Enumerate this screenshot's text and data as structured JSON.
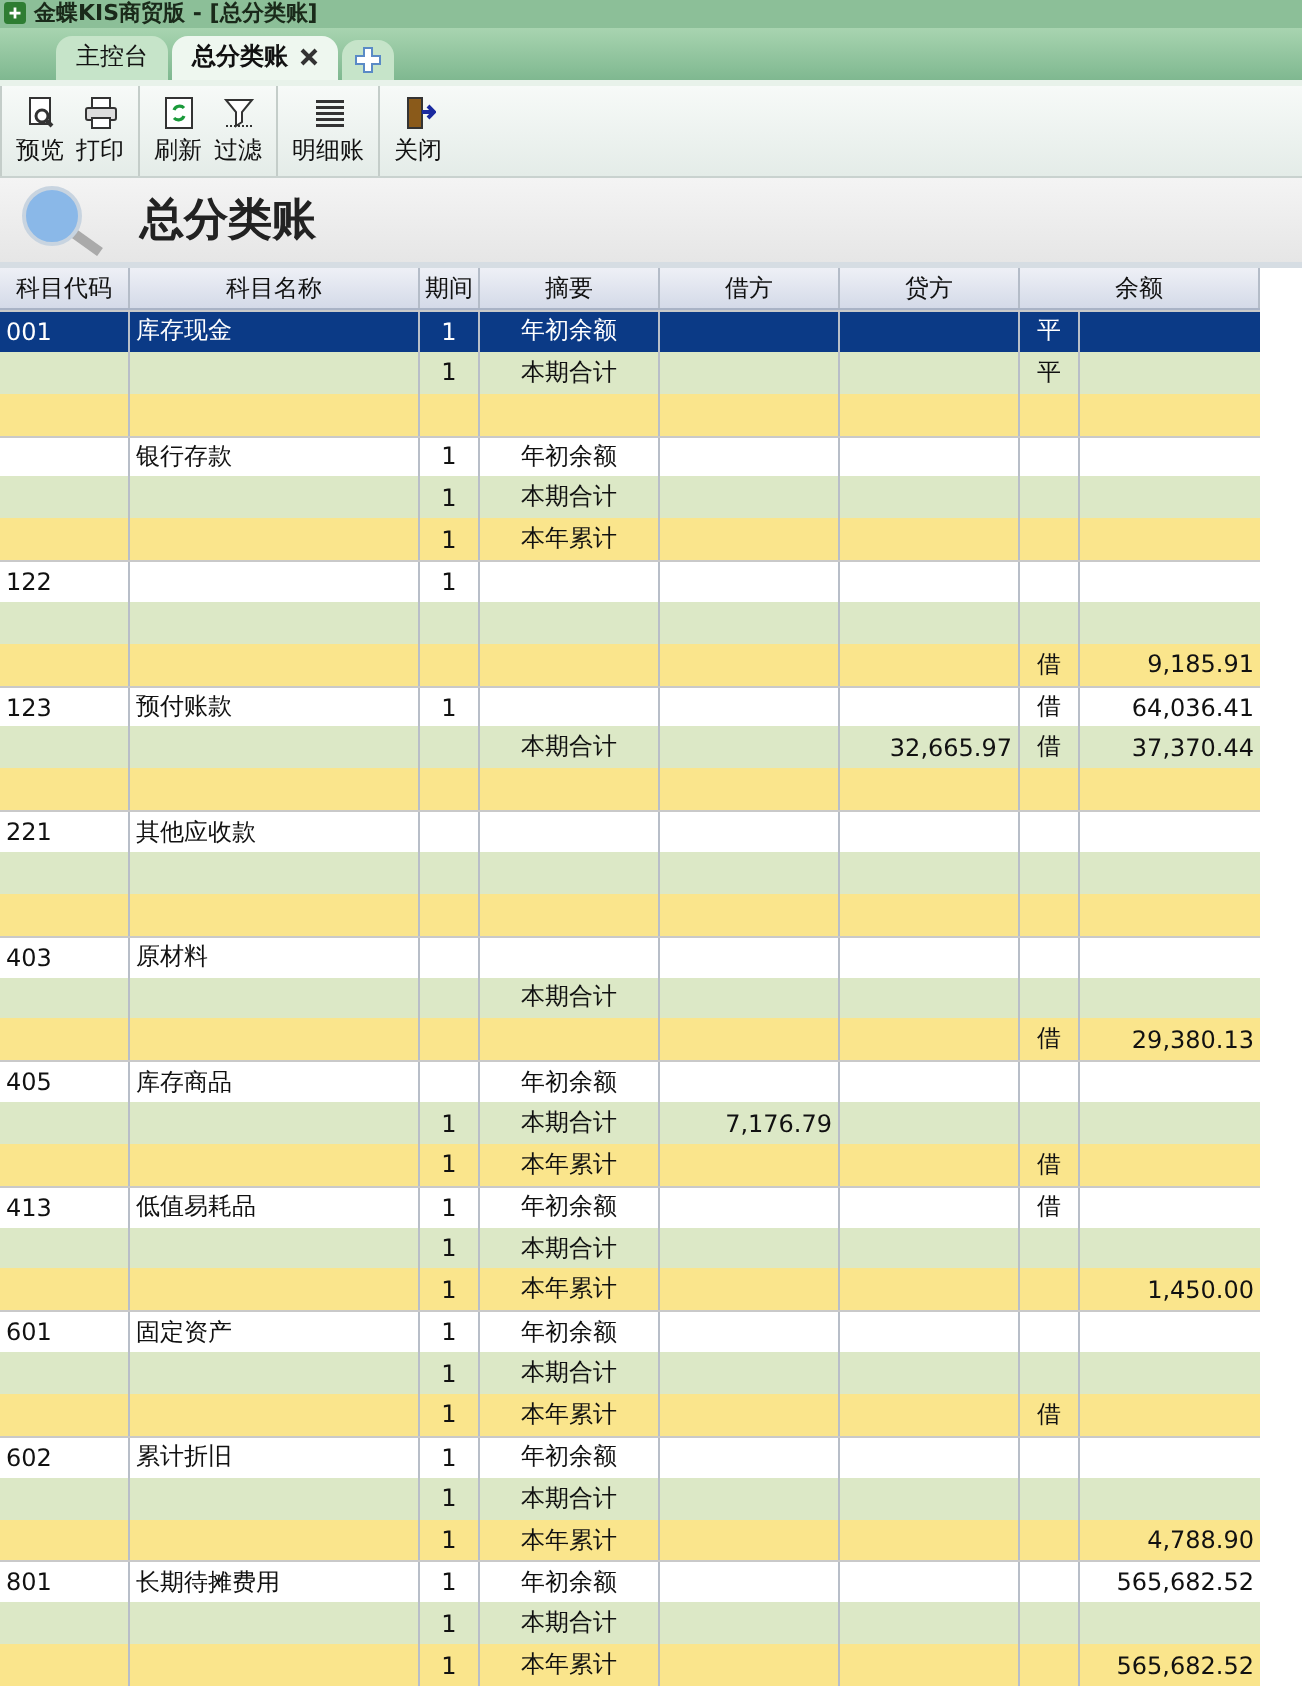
{
  "window": {
    "title": "金蝶KIS商贸版 - [总分类账]"
  },
  "tabs": [
    {
      "label": "主控台",
      "selected": false,
      "closable": false
    },
    {
      "label": "总分类账",
      "selected": true,
      "closable": true
    }
  ],
  "toolbar": [
    [
      {
        "label": "预览"
      },
      {
        "label": "打印"
      }
    ],
    [
      {
        "label": "刷新"
      },
      {
        "label": "过滤"
      }
    ],
    [
      {
        "label": "明细账"
      }
    ],
    [
      {
        "label": "关闭"
      }
    ]
  ],
  "heading": "总分类账",
  "table": {
    "columns": [
      "科目代码",
      "科目名称",
      "期间",
      "摘要",
      "借方",
      "贷方",
      "余额"
    ],
    "accounts": [
      {
        "code": "001",
        "name": "库存现金",
        "rows": [
          {
            "selected": true,
            "period": "1",
            "summary": "年初余额",
            "direction": "平"
          },
          {
            "selected": false,
            "period": "1",
            "summary": "本期合计",
            "direction": "平"
          },
          {
            "selected": false
          }
        ]
      },
      {
        "name": "银行存款",
        "rows": [
          {
            "selected": false,
            "period": "1",
            "summary": "年初余额"
          },
          {
            "selected": false,
            "period": "1",
            "summary": "本期合计"
          },
          {
            "selected": false,
            "period": "1",
            "summary": "本年累计"
          }
        ]
      },
      {
        "code": "122",
        "rows": [
          {
            "selected": false,
            "period": "1"
          },
          {
            "selected": false
          },
          {
            "selected": false,
            "direction": "借",
            "balance": "9,185.91"
          }
        ]
      },
      {
        "code": "123",
        "name": "预付账款",
        "rows": [
          {
            "selected": false,
            "period": "1",
            "direction": "借",
            "balance": "64,036.41"
          },
          {
            "selected": false,
            "summary": "本期合计",
            "credit": "32,665.97",
            "direction": "借",
            "balance": "37,370.44"
          },
          {
            "selected": false
          }
        ]
      },
      {
        "code": "221",
        "name": "其他应收款",
        "rows": [
          {
            "selected": false
          },
          {
            "selected": false
          },
          {
            "selected": false
          }
        ]
      },
      {
        "code": "403",
        "name": "原材料",
        "rows": [
          {
            "selected": false
          },
          {
            "selected": false,
            "summary": "本期合计"
          },
          {
            "selected": false,
            "direction": "借",
            "balance": "29,380.13"
          }
        ]
      },
      {
        "code": "405",
        "name": "库存商品",
        "rows": [
          {
            "selected": false,
            "summary": "年初余额"
          },
          {
            "selected": false,
            "period": "1",
            "summary": "本期合计",
            "debit": "7,176.79"
          },
          {
            "selected": false,
            "period": "1",
            "summary": "本年累计",
            "direction": "借"
          }
        ]
      },
      {
        "code": "413",
        "name": "低值易耗品",
        "rows": [
          {
            "selected": false,
            "period": "1",
            "summary": "年初余额",
            "direction": "借"
          },
          {
            "selected": false,
            "period": "1",
            "summary": "本期合计"
          },
          {
            "selected": false,
            "period": "1",
            "summary": "本年累计",
            "balance": "1,450.00"
          }
        ]
      },
      {
        "code": "601",
        "name": "固定资产",
        "rows": [
          {
            "selected": false,
            "period": "1",
            "summary": "年初余额"
          },
          {
            "selected": false,
            "period": "1",
            "summary": "本期合计"
          },
          {
            "selected": false,
            "period": "1",
            "summary": "本年累计",
            "direction": "借"
          }
        ]
      },
      {
        "code": "602",
        "name": "累计折旧",
        "rows": [
          {
            "selected": false,
            "period": "1",
            "summary": "年初余额"
          },
          {
            "selected": false,
            "period": "1",
            "summary": "本期合计"
          },
          {
            "selected": false,
            "period": "1",
            "summary": "本年累计",
            "balance": "4,788.90"
          }
        ]
      },
      {
        "code": "801",
        "name": "长期待摊费用",
        "rows": [
          {
            "selected": false,
            "period": "1",
            "summary": "年初余额",
            "balance": "565,682.52"
          },
          {
            "selected": false,
            "period": "1",
            "summary": "本期合计"
          },
          {
            "selected": false,
            "period": "1",
            "summary": "本年累计",
            "balance": "565,682.52"
          }
        ]
      }
    ]
  }
}
